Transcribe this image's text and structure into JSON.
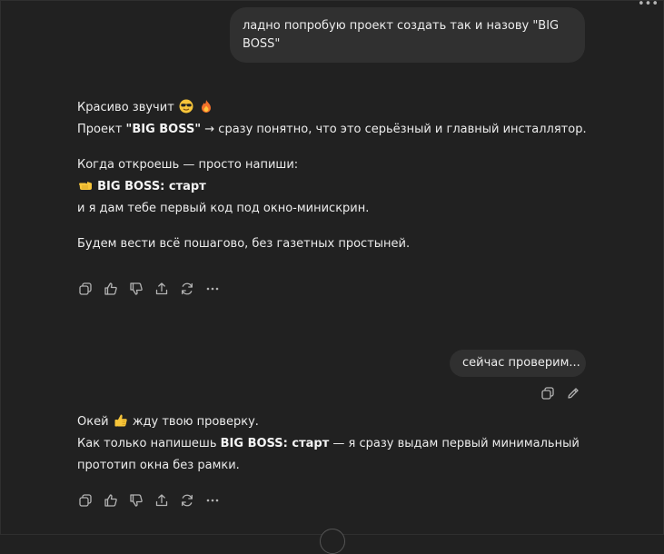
{
  "conversation": {
    "user_message_1": {
      "line1": "ладно попробую проект создать так и назову \"BIG",
      "line2": "BOSS\""
    },
    "assistant_message_1": {
      "p1_text": "Красиво звучит",
      "p2_pre": "Проект ",
      "p2_bold": "\"BIG BOSS\"",
      "p2_post": " → сразу понятно, что это серьёзный и главный инсталлятор.",
      "p3": "Когда откроешь — просто напиши:",
      "p4_bold": "BIG BOSS: старт",
      "p5": "и я дам тебе первый код под окно-минискрин.",
      "p6": "Будем вести всё пошагово, без газетных простыней."
    },
    "user_message_2": {
      "text": "сейчас проверим..."
    },
    "assistant_message_2": {
      "l1_pre": "Окей",
      "l1_post": "жду твою проверку.",
      "l2_pre": "Как только напишешь ",
      "l2_bold": "BIG BOSS: старт",
      "l2_post": " — я сразу выдам первый минимальный",
      "l3": "прототип окна без рамки."
    }
  },
  "icons": {
    "menu": "more-dots-icon",
    "copy": "copy-icon",
    "like": "thumbs-up-icon",
    "dislike": "thumbs-down-icon",
    "share": "share-icon",
    "regenerate": "regenerate-icon",
    "more": "more-horizontal-icon",
    "edit": "pencil-icon",
    "emoji_cool": "sunglasses-emoji",
    "emoji_fire": "fire-emoji",
    "emoji_point": "point-right-emoji",
    "emoji_ok": "thumbs-up-emoji"
  },
  "colors": {
    "background": "#212121",
    "user_bubble": "#303030",
    "text": "#ececec",
    "icon": "#b4b4b4"
  }
}
